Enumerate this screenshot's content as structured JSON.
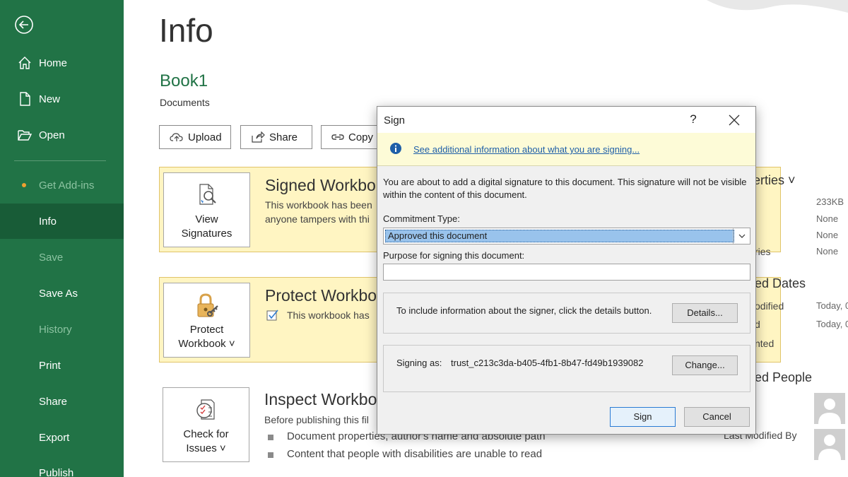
{
  "colors": {
    "brand": "#217346",
    "active": "#185c37",
    "dialog_bg": "#f0f0f0",
    "info_bar": "#fdfbd7",
    "link": "#1f5fa8"
  },
  "sidebar": {
    "back_icon": "back-arrow-icon",
    "items": [
      {
        "label": "Home",
        "icon": "home-icon",
        "state": "normal"
      },
      {
        "label": "New",
        "icon": "new-document-icon",
        "state": "normal"
      },
      {
        "label": "Open",
        "icon": "folder-open-icon",
        "state": "normal"
      },
      {
        "label": "Get Add-ins",
        "icon": "dot",
        "state": "disabled"
      },
      {
        "label": "Info",
        "state": "active"
      },
      {
        "label": "Save",
        "state": "disabled"
      },
      {
        "label": "Save As",
        "state": "normal"
      },
      {
        "label": "History",
        "state": "disabled"
      },
      {
        "label": "Print",
        "state": "normal"
      },
      {
        "label": "Share",
        "state": "normal"
      },
      {
        "label": "Export",
        "state": "normal"
      },
      {
        "label": "Publish",
        "state": "normal"
      }
    ]
  },
  "main": {
    "page_title": "Info",
    "book_title": "Book1",
    "book_location": "Documents",
    "toolbar": {
      "upload": "Upload",
      "share": "Share",
      "copy": "Copy p"
    },
    "cards": {
      "signed": {
        "tile": [
          "View",
          "Signatures"
        ],
        "heading": "Signed Workbo",
        "lines": [
          "This workbook has been",
          "anyone tampers with thi"
        ]
      },
      "protect": {
        "tile": [
          "Protect",
          "Workbook ˅"
        ],
        "heading": "Protect Workbo",
        "lines": [
          "This workbook has"
        ]
      },
      "inspect": {
        "tile": [
          "Check for",
          "Issues ˅"
        ],
        "heading": "Inspect Workbo",
        "lines": [
          "Before publishing this fil"
        ],
        "bullets": [
          "Document properties, author's name and absolute path",
          "Content that people with disabilities are unable to read"
        ]
      }
    },
    "properties": {
      "heading": "erties ˅",
      "size": "233KB",
      "none1": "None",
      "none2": "None",
      "ries": "ries",
      "none3": "None",
      "dates_heading": "ed Dates",
      "odified": "odified",
      "today1": "Today, 0",
      "d": "d",
      "today2": "Today, 0",
      "nted": "nted",
      "people_heading": "ed People",
      "last_modified_by": "Last Modified By"
    }
  },
  "dialog": {
    "title": "Sign",
    "help": "?",
    "info_link": "See additional information about what you are signing...",
    "description": "You are about to add a digital signature to this document. This signature will not be visible within the content of this document.",
    "commitment_label": "Commitment Type:",
    "commitment_value": "Approved this document",
    "purpose_label": "Purpose for signing this document:",
    "purpose_value": "",
    "details_text": "To include information about the signer, click the details button.",
    "details_button": "Details...",
    "signing_as_label": "Signing as:",
    "signing_as_value": "trust_c213c3da-b405-4fb1-8b47-fd49b1939082",
    "change_button": "Change...",
    "sign_button": "Sign",
    "cancel_button": "Cancel"
  }
}
